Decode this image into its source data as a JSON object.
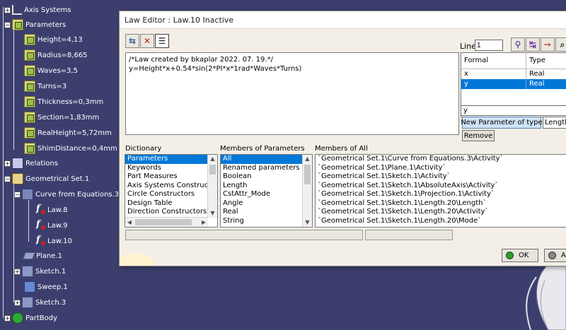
{
  "tree": {
    "items": [
      {
        "label": "Axis Systems",
        "icon": "axis"
      },
      {
        "label": "Parameters",
        "icon": "param"
      },
      {
        "label": "Height=4,13",
        "icon": "param"
      },
      {
        "label": "Radius=8,665",
        "icon": "param"
      },
      {
        "label": "Waves=3,5",
        "icon": "param"
      },
      {
        "label": "Turns=3",
        "icon": "param"
      },
      {
        "label": "Thickness=0,3mm",
        "icon": "param"
      },
      {
        "label": "Section=1,83mm",
        "icon": "param"
      },
      {
        "label": "RealHeight=5,72mm",
        "icon": "param"
      },
      {
        "label": "ShimDistance=0,4mm",
        "icon": "param"
      },
      {
        "label": "Relations",
        "icon": "relations"
      },
      {
        "label": "Geometrical Set.1",
        "icon": "geoset"
      },
      {
        "label": "Curve from Equations.3",
        "icon": "curve"
      },
      {
        "label": "Law.8",
        "icon": "law"
      },
      {
        "label": "Law.9",
        "icon": "law"
      },
      {
        "label": "Law.10",
        "icon": "law"
      },
      {
        "label": "Plane.1",
        "icon": "plane"
      },
      {
        "label": "Sketch.1",
        "icon": "sketch"
      },
      {
        "label": "Sweep.1",
        "icon": "sweep"
      },
      {
        "label": "Sketch.3",
        "icon": "sketch"
      },
      {
        "label": "PartBody",
        "icon": "partbody"
      }
    ]
  },
  "dialog": {
    "title": "Law Editor : Law.10 Inactive",
    "line_label": "Line:",
    "line_value": "1",
    "editor_lines": [
      "/*Law created by bkaplar 2022. 07. 19.*/",
      "y=Height*x+0.54*sin(2*PI*x*1rad*Waves*Turns)"
    ],
    "formal_table": {
      "headers": [
        "Formal parameters",
        "Type"
      ],
      "rows": [
        {
          "name": "x",
          "type": "Real"
        },
        {
          "name": "y",
          "type": "Real"
        }
      ]
    },
    "param_input_value": "y",
    "new_param_button": "New Parameter of type",
    "type_combo_value": "Length",
    "remove_button": "Remove",
    "dictionary": {
      "label": "Dictionary",
      "items": [
        "Parameters",
        "Keywords",
        "Part Measures",
        "Axis Systems Constructor",
        "Circle Constructors",
        "Design Table",
        "Direction Constructors"
      ]
    },
    "members_of_parameters": {
      "label": "Members of Parameters",
      "items": [
        "All",
        "Renamed parameters",
        "Boolean",
        "Length",
        "CstAttr_Mode",
        "Angle",
        "Real",
        "String"
      ]
    },
    "members_of_all": {
      "label": "Members of All",
      "items": [
        "`Geometrical Set.1\\Curve from Equations.3\\Activity`",
        "`Geometrical Set.1\\Plane.1\\Activity`",
        "`Geometrical Set.1\\Sketch.1\\Activity`",
        "`Geometrical Set.1\\Sketch.1\\AbsoluteAxis\\Activity`",
        "`Geometrical Set.1\\Sketch.1\\Projection.1\\Activity`",
        "`Geometrical Set.1\\Sketch.1\\Length.20\\Length`",
        "`Geometrical Set.1\\Sketch.1\\Length.20\\Activity`",
        "`Geometrical Set.1\\Sketch.1\\Length.20\\Mode`"
      ]
    },
    "ok_button": "OK",
    "apply_button": "Ap"
  }
}
